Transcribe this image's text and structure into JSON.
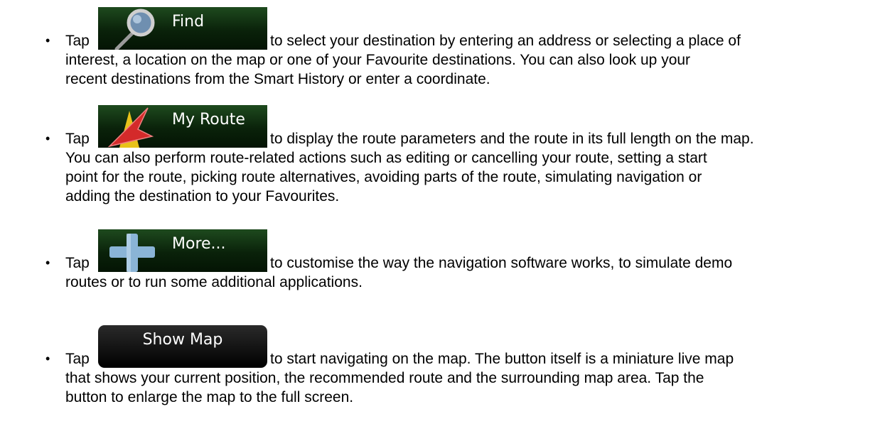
{
  "bullet_char": "•",
  "items": [
    {
      "tap": "Tap",
      "button_label": "Find",
      "icon": "magnifier-icon",
      "rest": "to select your destination by entering an address or selecting a place of",
      "lines": [
        "interest, a location on the map or one of your Favourite destinations. You can also look up your",
        "recent destinations from the Smart History or enter a coordinate."
      ]
    },
    {
      "tap": "Tap",
      "button_label": "My Route",
      "icon": "route-arrow-icon",
      "rest": "to display the route parameters and the route in its full length on the map.",
      "lines": [
        "You can also perform route-related actions such as editing or cancelling your route, setting a start",
        "point for the route, picking route alternatives, avoiding parts of the route, simulating navigation or",
        "adding the destination to your Favourites."
      ]
    },
    {
      "tap": "Tap",
      "button_label": "More...",
      "icon": "plus-icon",
      "rest": "to customise the way the navigation software works, to simulate demo",
      "lines": [
        "routes or to run some additional applications."
      ]
    },
    {
      "tap": "Tap",
      "button_label": "Show Map",
      "icon": "",
      "rest": "to start navigating on the map. The button itself is a miniature live map",
      "lines": [
        "that shows your current position, the recommended route and the surrounding map area. Tap the",
        "button to enlarge the map to the full screen."
      ]
    }
  ]
}
